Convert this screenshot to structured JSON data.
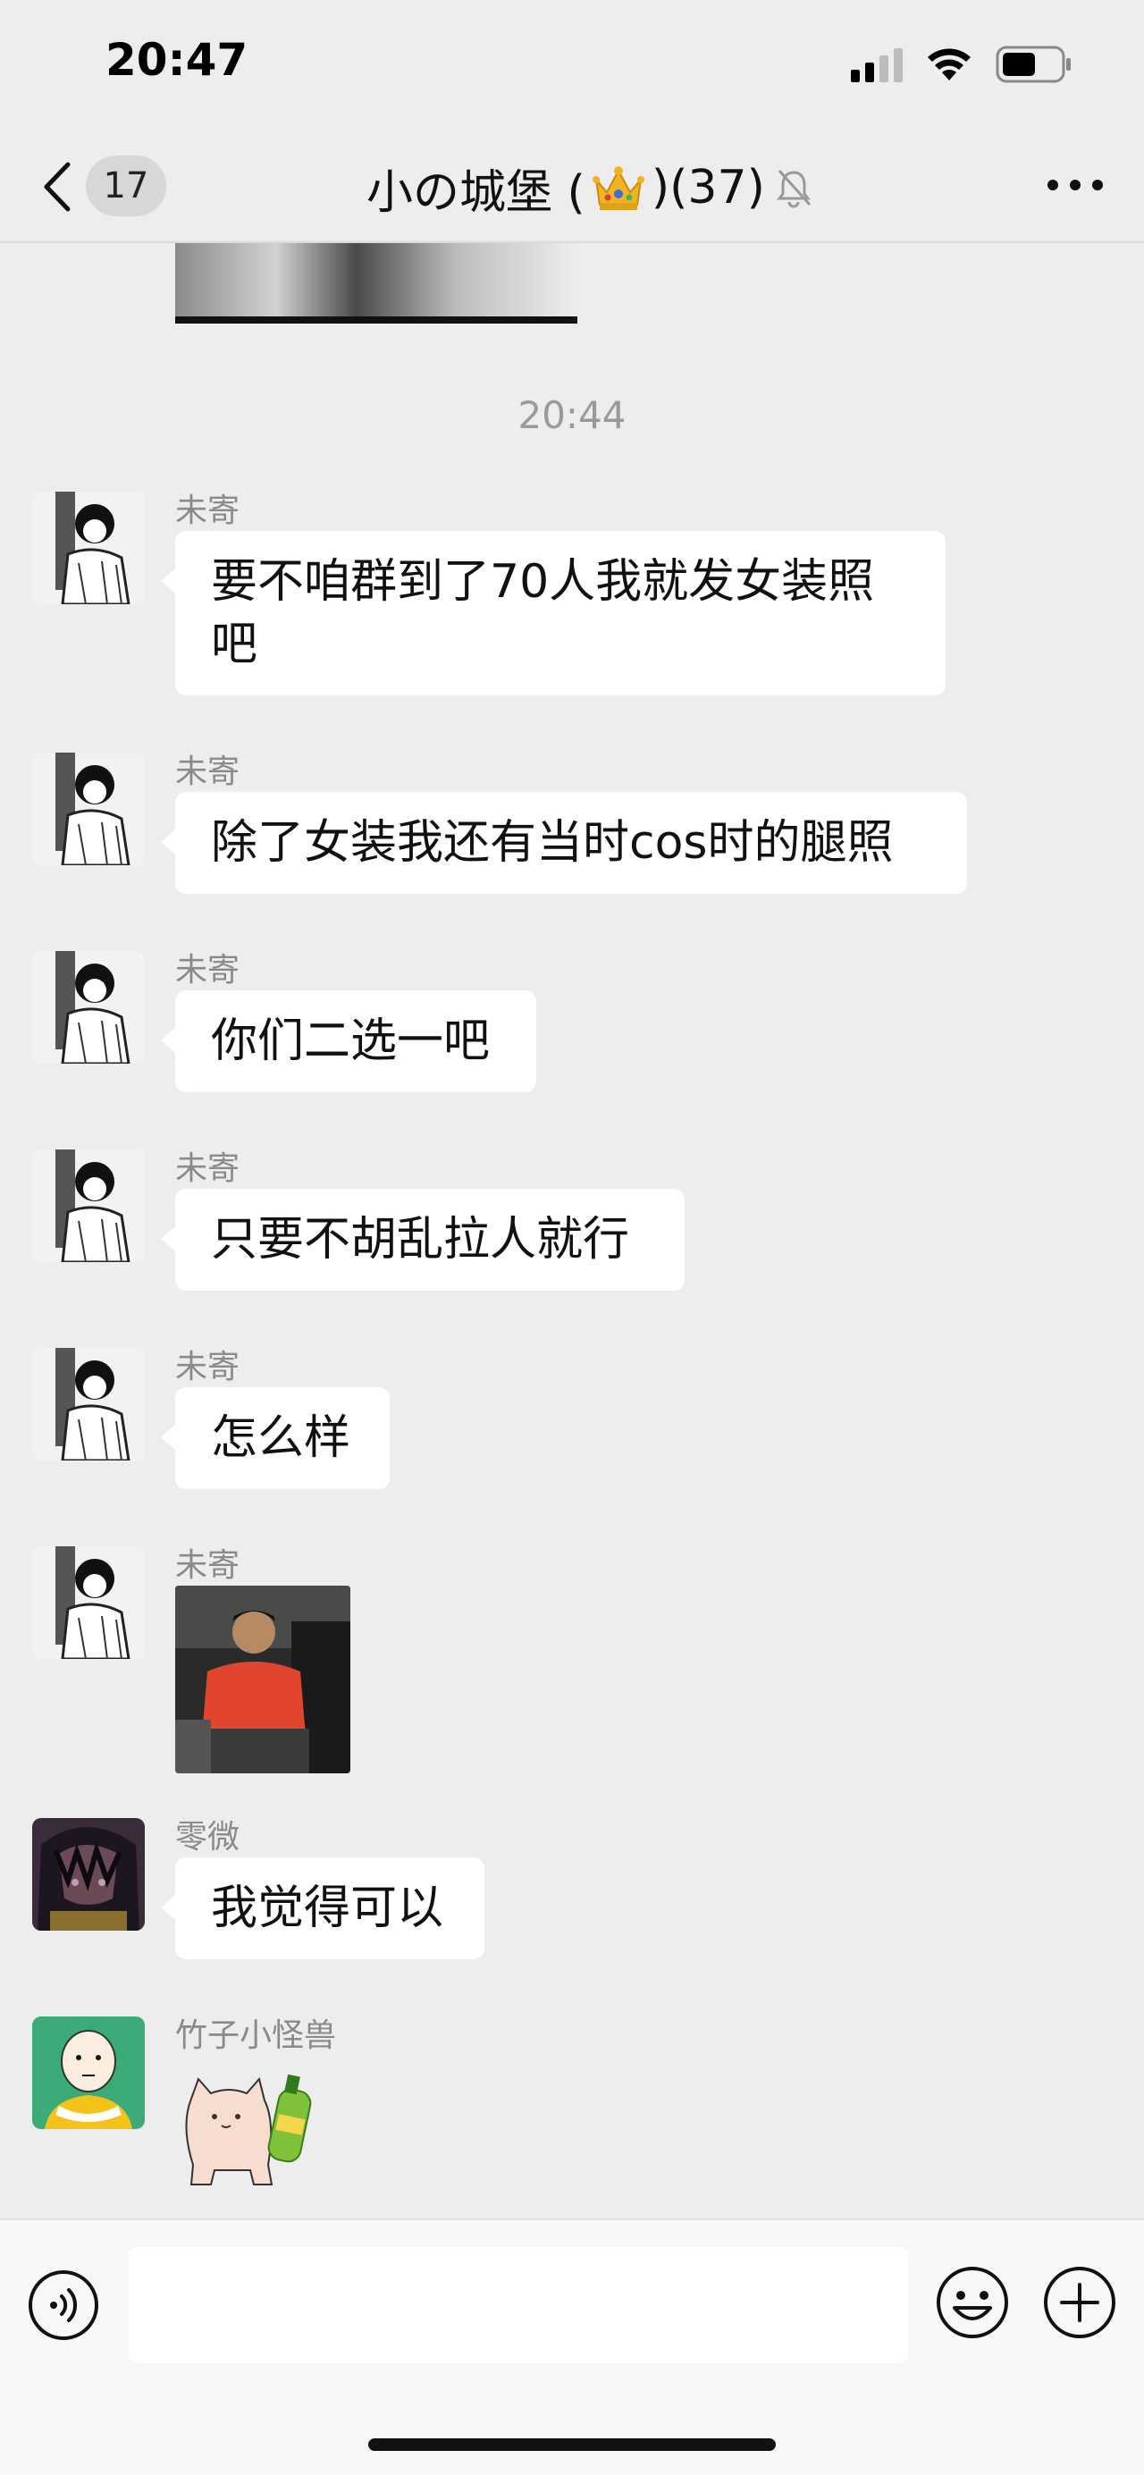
{
  "status_bar": {
    "time": "20:47"
  },
  "nav": {
    "unread_count": "17",
    "title_prefix": "小の城堡 (",
    "title_suffix": " )(37)"
  },
  "chat": {
    "timestamp": "20:44",
    "messages": [
      {
        "sender": "未寄",
        "text": "要不咱群到了70人我就发女装照\n吧"
      },
      {
        "sender": "未寄",
        "text": "除了女装我还有当时cos时的腿照"
      },
      {
        "sender": "未寄",
        "text": "你们二选一吧"
      },
      {
        "sender": "未寄",
        "text": "只要不胡乱拉人就行"
      },
      {
        "sender": "未寄",
        "text": "怎么样"
      },
      {
        "sender": "未寄",
        "text": ""
      },
      {
        "sender": "零微",
        "text": "我觉得可以"
      },
      {
        "sender": "竹子小怪兽",
        "text": ""
      }
    ]
  },
  "input_bar": {
    "placeholder": ""
  }
}
